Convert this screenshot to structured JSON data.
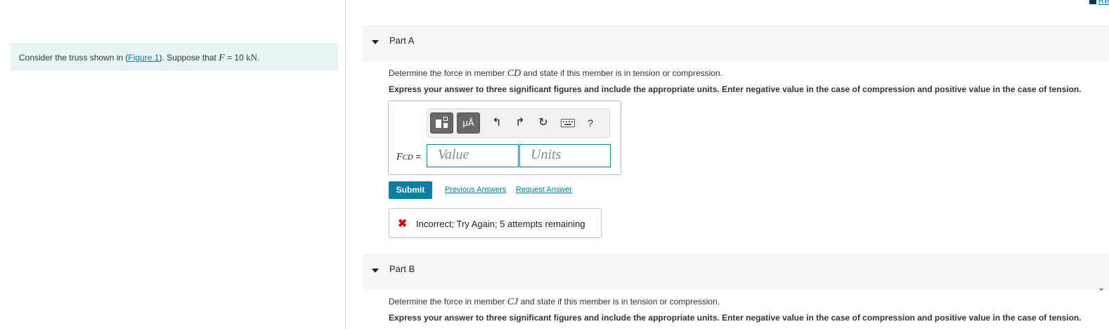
{
  "prompt": {
    "text_before": "Consider the truss shown in (",
    "figure_link": "Figure 1",
    "text_after": "). Suppose that ",
    "var_F": "F",
    "equals": " = 10 ",
    "unit": "kN",
    "period": "."
  },
  "review_link": "Re",
  "partA": {
    "title": "Part A",
    "question_before": "Determine the force in member ",
    "member": "CD",
    "question_after": " and state if this member is in tension or compression.",
    "instructions": "Express your answer to three significant figures and include the appropriate units. Enter negative value in the case of compression and positive value in the case of tension.",
    "toolbar": {
      "mu_label": "μÅ",
      "undo_glyph": "↰",
      "redo_glyph": "↱",
      "reset_glyph": "↻",
      "help_glyph": "?"
    },
    "var_F": "F",
    "var_sub": "CD",
    "equals": " =",
    "value_placeholder": "Value",
    "units_placeholder": "Units",
    "submit_label": "Submit",
    "previous_answers": "Previous Answers",
    "request_answer": "Request Answer",
    "feedback_icon": "✖",
    "feedback": "Incorrect; Try Again; 5 attempts remaining"
  },
  "partB": {
    "title": "Part B",
    "question_before": "Determine the force in member ",
    "member": "CJ",
    "question_after": " and state if this member is in tension or compression.",
    "instructions": "Express your answer to three significant figures and include the appropriate units. Enter negative value in the case of compression and positive value in the case of tension."
  },
  "colors": {
    "accent": "#007fa3",
    "error": "#d0021b",
    "prompt_bg": "#e6f4f6"
  }
}
